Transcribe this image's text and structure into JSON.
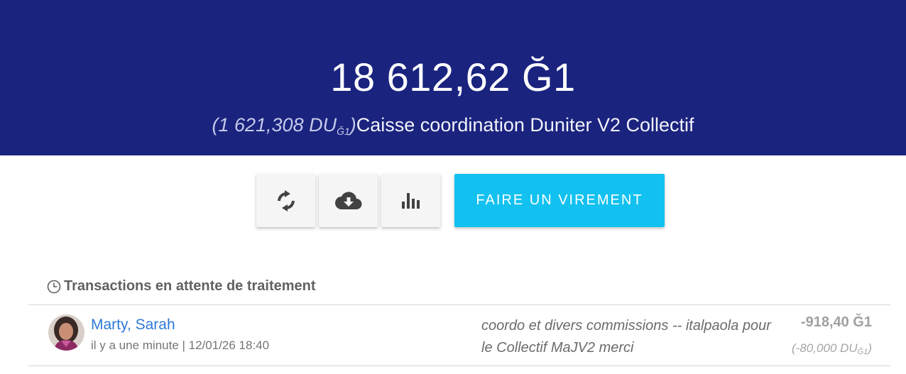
{
  "header": {
    "balance": "18 612,62 Ğ1",
    "balance_ud": "(1 621,308 DU",
    "balance_ud_currency": "Ğ1",
    "balance_ud_close": ")",
    "wallet_name": "Caisse coordination Duniter V2 Collectif",
    "background_color": "#1a237e"
  },
  "toolbar": {
    "refresh_icon": "refresh-icon",
    "download_icon": "cloud-download-icon",
    "stats_icon": "bar-chart-icon",
    "transfer_label": "FAIRE UN VIREMENT",
    "transfer_color": "#12c1f0"
  },
  "pending": {
    "title": "Transactions en attente de traitement",
    "icon": "clock-icon",
    "transactions": [
      {
        "name": "Marty, Sarah",
        "time": "il y a une minute | 12/01/26 18:40",
        "comment_line1": "coordo et divers commissions -- italpaola pour",
        "comment_line2": "le Collectif MaJV2 merci",
        "amount": "-918,40 Ğ1",
        "amount_ud": "(-80,000 DU",
        "amount_ud_currency": "Ğ1",
        "amount_ud_close": ")"
      }
    ]
  }
}
